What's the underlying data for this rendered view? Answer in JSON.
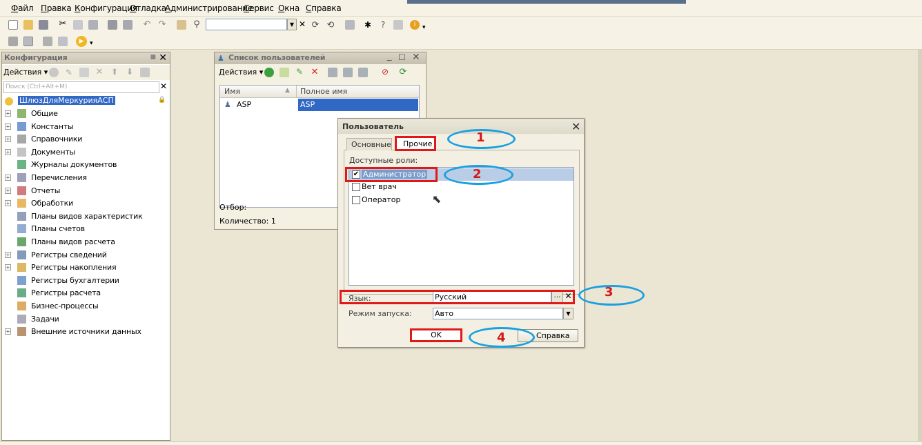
{
  "menu": [
    "Файл",
    "Правка",
    "Конфигурация",
    "Отладка",
    "Администрирование",
    "Сервис",
    "Окна",
    "Справка"
  ],
  "config_panel": {
    "title": "Конфигурация",
    "actions_label": "Действия",
    "search_placeholder": "Поиск (Ctrl+Alt+M)",
    "root": "ШлюзДляМеркурияАСП",
    "items": [
      {
        "label": "Общие",
        "expandable": true
      },
      {
        "label": "Константы",
        "expandable": true
      },
      {
        "label": "Справочники",
        "expandable": true
      },
      {
        "label": "Документы",
        "expandable": true
      },
      {
        "label": "Журналы документов",
        "expandable": false
      },
      {
        "label": "Перечисления",
        "expandable": true
      },
      {
        "label": "Отчеты",
        "expandable": true
      },
      {
        "label": "Обработки",
        "expandable": true
      },
      {
        "label": "Планы видов характеристик",
        "expandable": false
      },
      {
        "label": "Планы счетов",
        "expandable": false
      },
      {
        "label": "Планы видов расчета",
        "expandable": false
      },
      {
        "label": "Регистры сведений",
        "expandable": true
      },
      {
        "label": "Регистры накопления",
        "expandable": true
      },
      {
        "label": "Регистры бухгалтерии",
        "expandable": false
      },
      {
        "label": "Регистры расчета",
        "expandable": false
      },
      {
        "label": "Бизнес-процессы",
        "expandable": false
      },
      {
        "label": "Задачи",
        "expandable": false
      },
      {
        "label": "Внешние источники данных",
        "expandable": true
      }
    ]
  },
  "users_window": {
    "title": "Список пользователей",
    "actions_label": "Действия",
    "columns": [
      "Имя",
      "Полное имя"
    ],
    "rows": [
      {
        "name": "ASP",
        "full_name": "ASP"
      }
    ],
    "filter_label": "Отбор:",
    "count_label": "Количество: 1"
  },
  "user_dialog": {
    "title": "Пользователь",
    "tabs": [
      "Основные",
      "Прочие"
    ],
    "roles_label": "Доступные роли:",
    "roles": [
      {
        "label": "Администратор",
        "checked": true
      },
      {
        "label": "Вет врач",
        "checked": false
      },
      {
        "label": "Оператор",
        "checked": false
      }
    ],
    "language_label": "Язык:",
    "language_value": "Русский",
    "launch_mode_label": "Режим запуска:",
    "launch_mode_value": "Авто",
    "ok_label": "OK",
    "help_label": "Справка"
  },
  "callouts": [
    "1",
    "2",
    "3",
    "4"
  ],
  "colors": {
    "highlight_red": "#e01818",
    "callout_blue": "#19a0e0",
    "selection": "#3168c6",
    "workspace": "#ebe5d3"
  }
}
